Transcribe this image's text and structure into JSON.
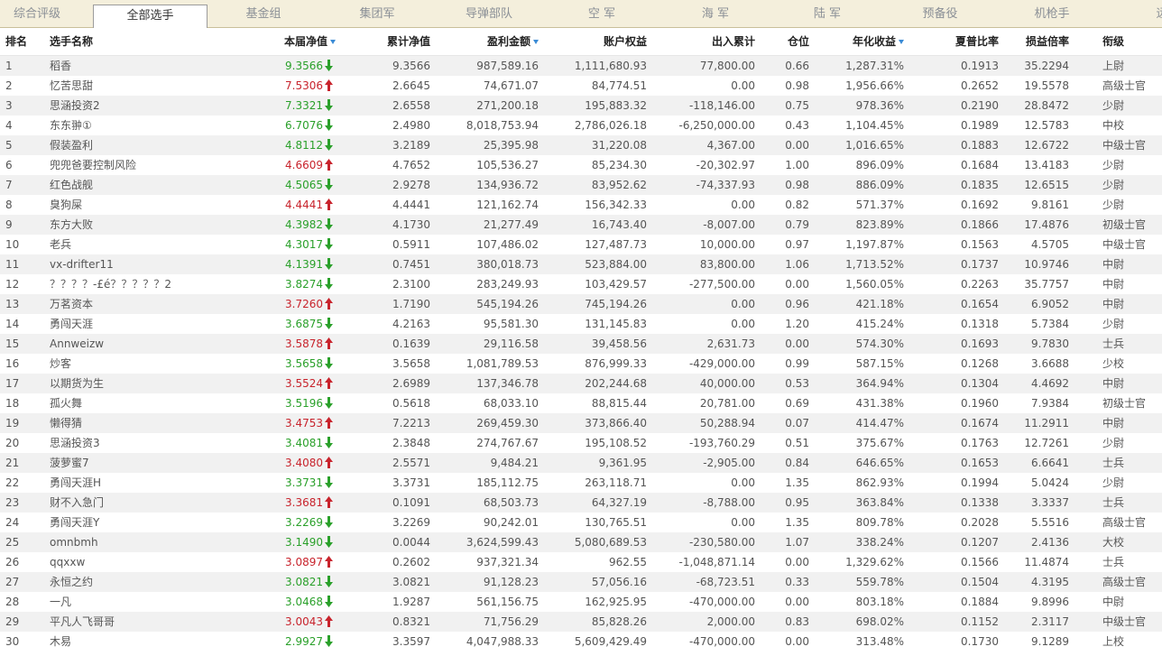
{
  "tabs": [
    {
      "label": "综合评级",
      "active": false
    },
    {
      "label": "全部选手",
      "active": true
    },
    {
      "label": "基金组",
      "active": false
    },
    {
      "label": "集团军",
      "active": false
    },
    {
      "label": "导弹部队",
      "active": false
    },
    {
      "label": "空  军",
      "active": false
    },
    {
      "label": "海  军",
      "active": false
    },
    {
      "label": "陆  军",
      "active": false
    },
    {
      "label": "预备役",
      "active": false
    },
    {
      "label": "机枪手",
      "active": false
    },
    {
      "label": "远",
      "active": false
    }
  ],
  "columns": [
    {
      "key": "rank",
      "label": "排名",
      "sortable": false
    },
    {
      "key": "name",
      "label": "选手名称",
      "sortable": false
    },
    {
      "key": "nav",
      "label": "本届净值",
      "sortable": true
    },
    {
      "key": "cum_nav",
      "label": "累计净值",
      "sortable": false
    },
    {
      "key": "profit",
      "label": "盈利金额",
      "sortable": true
    },
    {
      "key": "equity",
      "label": "账户权益",
      "sortable": false
    },
    {
      "key": "flow",
      "label": "出入累计",
      "sortable": false
    },
    {
      "key": "position",
      "label": "仓位",
      "sortable": false
    },
    {
      "key": "annual",
      "label": "年化收益",
      "sortable": true
    },
    {
      "key": "sharpe",
      "label": "夏普比率",
      "sortable": false
    },
    {
      "key": "pl_ratio",
      "label": "损益倍率",
      "sortable": false
    },
    {
      "key": "grade",
      "label": "衔级",
      "sortable": false
    }
  ],
  "colors": {
    "up": "#c8232c",
    "down": "#2aa02a",
    "accent": "#3a8bd6"
  },
  "rows": [
    {
      "rank": "1",
      "name": "稻香",
      "nav": "9.3566",
      "dir": "down",
      "cum_nav": "9.3566",
      "profit": "987,589.16",
      "equity": "1,111,680.93",
      "flow": "77,800.00",
      "position": "0.66",
      "annual": "1,287.31%",
      "sharpe": "0.1913",
      "pl_ratio": "35.2294",
      "grade": "上尉"
    },
    {
      "rank": "2",
      "name": "忆苦思甜",
      "nav": "7.5306",
      "dir": "up",
      "cum_nav": "2.6645",
      "profit": "74,671.07",
      "equity": "84,774.51",
      "flow": "0.00",
      "position": "0.98",
      "annual": "1,956.66%",
      "sharpe": "0.2652",
      "pl_ratio": "19.5578",
      "grade": "高级士官"
    },
    {
      "rank": "3",
      "name": "思涵投资2",
      "nav": "7.3321",
      "dir": "down",
      "cum_nav": "2.6558",
      "profit": "271,200.18",
      "equity": "195,883.32",
      "flow": "-118,146.00",
      "position": "0.75",
      "annual": "978.36%",
      "sharpe": "0.2190",
      "pl_ratio": "28.8472",
      "grade": "少尉"
    },
    {
      "rank": "4",
      "name": "东东翀①",
      "nav": "6.7076",
      "dir": "down",
      "cum_nav": "2.4980",
      "profit": "8,018,753.94",
      "equity": "2,786,026.18",
      "flow": "-6,250,000.00",
      "position": "0.43",
      "annual": "1,104.45%",
      "sharpe": "0.1989",
      "pl_ratio": "12.5783",
      "grade": "中校"
    },
    {
      "rank": "5",
      "name": "假装盈利",
      "nav": "4.8112",
      "dir": "down",
      "cum_nav": "3.2189",
      "profit": "25,395.98",
      "equity": "31,220.08",
      "flow": "4,367.00",
      "position": "0.00",
      "annual": "1,016.65%",
      "sharpe": "0.1883",
      "pl_ratio": "12.6722",
      "grade": "中级士官"
    },
    {
      "rank": "6",
      "name": "兜兜爸要控制风险",
      "nav": "4.6609",
      "dir": "up",
      "cum_nav": "4.7652",
      "profit": "105,536.27",
      "equity": "85,234.30",
      "flow": "-20,302.97",
      "position": "1.00",
      "annual": "896.09%",
      "sharpe": "0.1684",
      "pl_ratio": "13.4183",
      "grade": "少尉"
    },
    {
      "rank": "7",
      "name": "红色战舰",
      "nav": "4.5065",
      "dir": "down",
      "cum_nav": "2.9278",
      "profit": "134,936.72",
      "equity": "83,952.62",
      "flow": "-74,337.93",
      "position": "0.98",
      "annual": "886.09%",
      "sharpe": "0.1835",
      "pl_ratio": "12.6515",
      "grade": "少尉"
    },
    {
      "rank": "8",
      "name": "臭狗屎",
      "nav": "4.4441",
      "dir": "up",
      "cum_nav": "4.4441",
      "profit": "121,162.74",
      "equity": "156,342.33",
      "flow": "0.00",
      "position": "0.82",
      "annual": "571.37%",
      "sharpe": "0.1692",
      "pl_ratio": "9.8161",
      "grade": "少尉"
    },
    {
      "rank": "9",
      "name": "东方大败",
      "nav": "4.3982",
      "dir": "down",
      "cum_nav": "4.1730",
      "profit": "21,277.49",
      "equity": "16,743.40",
      "flow": "-8,007.00",
      "position": "0.79",
      "annual": "823.89%",
      "sharpe": "0.1866",
      "pl_ratio": "17.4876",
      "grade": "初级士官"
    },
    {
      "rank": "10",
      "name": "老兵",
      "nav": "4.3017",
      "dir": "down",
      "cum_nav": "0.5911",
      "profit": "107,486.02",
      "equity": "127,487.73",
      "flow": "10,000.00",
      "position": "0.97",
      "annual": "1,197.87%",
      "sharpe": "0.1563",
      "pl_ratio": "4.5705",
      "grade": "中级士官"
    },
    {
      "rank": "11",
      "name": "vx-drifter11",
      "nav": "4.1391",
      "dir": "down",
      "cum_nav": "0.7451",
      "profit": "380,018.73",
      "equity": "523,884.00",
      "flow": "83,800.00",
      "position": "1.06",
      "annual": "1,713.52%",
      "sharpe": "0.1737",
      "pl_ratio": "10.9746",
      "grade": "中尉"
    },
    {
      "rank": "12",
      "name": "？？？？-£é？？？？？2",
      "nav": "3.8274",
      "dir": "down",
      "cum_nav": "2.3100",
      "profit": "283,249.93",
      "equity": "103,429.57",
      "flow": "-277,500.00",
      "position": "0.00",
      "annual": "1,560.05%",
      "sharpe": "0.2263",
      "pl_ratio": "35.7757",
      "grade": "中尉"
    },
    {
      "rank": "13",
      "name": "万茗资本",
      "nav": "3.7260",
      "dir": "up",
      "cum_nav": "1.7190",
      "profit": "545,194.26",
      "equity": "745,194.26",
      "flow": "0.00",
      "position": "0.96",
      "annual": "421.18%",
      "sharpe": "0.1654",
      "pl_ratio": "6.9052",
      "grade": "中尉"
    },
    {
      "rank": "14",
      "name": "勇闯天涯",
      "nav": "3.6875",
      "dir": "down",
      "cum_nav": "4.2163",
      "profit": "95,581.30",
      "equity": "131,145.83",
      "flow": "0.00",
      "position": "1.20",
      "annual": "415.24%",
      "sharpe": "0.1318",
      "pl_ratio": "5.7384",
      "grade": "少尉"
    },
    {
      "rank": "15",
      "name": "Annweizw",
      "nav": "3.5878",
      "dir": "up",
      "cum_nav": "0.1639",
      "profit": "29,116.58",
      "equity": "39,458.56",
      "flow": "2,631.73",
      "position": "0.00",
      "annual": "574.30%",
      "sharpe": "0.1693",
      "pl_ratio": "9.7830",
      "grade": "士兵"
    },
    {
      "rank": "16",
      "name": "炒客",
      "nav": "3.5658",
      "dir": "down",
      "cum_nav": "3.5658",
      "profit": "1,081,789.53",
      "equity": "876,999.33",
      "flow": "-429,000.00",
      "position": "0.99",
      "annual": "587.15%",
      "sharpe": "0.1268",
      "pl_ratio": "3.6688",
      "grade": "少校"
    },
    {
      "rank": "17",
      "name": "以期货为生",
      "nav": "3.5524",
      "dir": "up",
      "cum_nav": "2.6989",
      "profit": "137,346.78",
      "equity": "202,244.68",
      "flow": "40,000.00",
      "position": "0.53",
      "annual": "364.94%",
      "sharpe": "0.1304",
      "pl_ratio": "4.4692",
      "grade": "中尉"
    },
    {
      "rank": "18",
      "name": "孤火舞",
      "nav": "3.5196",
      "dir": "down",
      "cum_nav": "0.5618",
      "profit": "68,033.10",
      "equity": "88,815.44",
      "flow": "20,781.00",
      "position": "0.69",
      "annual": "431.38%",
      "sharpe": "0.1960",
      "pl_ratio": "7.9384",
      "grade": "初级士官"
    },
    {
      "rank": "19",
      "name": "懒得猜",
      "nav": "3.4753",
      "dir": "up",
      "cum_nav": "7.2213",
      "profit": "269,459.30",
      "equity": "373,866.40",
      "flow": "50,288.94",
      "position": "0.07",
      "annual": "414.47%",
      "sharpe": "0.1674",
      "pl_ratio": "11.2911",
      "grade": "中尉"
    },
    {
      "rank": "20",
      "name": "思涵投资3",
      "nav": "3.4081",
      "dir": "down",
      "cum_nav": "2.3848",
      "profit": "274,767.67",
      "equity": "195,108.52",
      "flow": "-193,760.29",
      "position": "0.51",
      "annual": "375.67%",
      "sharpe": "0.1763",
      "pl_ratio": "12.7261",
      "grade": "少尉"
    },
    {
      "rank": "21",
      "name": "菠萝蜜7",
      "nav": "3.4080",
      "dir": "up",
      "cum_nav": "2.5571",
      "profit": "9,484.21",
      "equity": "9,361.95",
      "flow": "-2,905.00",
      "position": "0.84",
      "annual": "646.65%",
      "sharpe": "0.1653",
      "pl_ratio": "6.6641",
      "grade": "士兵"
    },
    {
      "rank": "22",
      "name": "勇闯天涯H",
      "nav": "3.3731",
      "dir": "down",
      "cum_nav": "3.3731",
      "profit": "185,112.75",
      "equity": "263,118.71",
      "flow": "0.00",
      "position": "1.35",
      "annual": "862.93%",
      "sharpe": "0.1994",
      "pl_ratio": "5.0424",
      "grade": "少尉"
    },
    {
      "rank": "23",
      "name": "财不入急门",
      "nav": "3.3681",
      "dir": "up",
      "cum_nav": "0.1091",
      "profit": "68,503.73",
      "equity": "64,327.19",
      "flow": "-8,788.00",
      "position": "0.95",
      "annual": "363.84%",
      "sharpe": "0.1338",
      "pl_ratio": "3.3337",
      "grade": "士兵"
    },
    {
      "rank": "24",
      "name": "勇闯天涯Y",
      "nav": "3.2269",
      "dir": "down",
      "cum_nav": "3.2269",
      "profit": "90,242.01",
      "equity": "130,765.51",
      "flow": "0.00",
      "position": "1.35",
      "annual": "809.78%",
      "sharpe": "0.2028",
      "pl_ratio": "5.5516",
      "grade": "高级士官"
    },
    {
      "rank": "25",
      "name": "omnbmh",
      "nav": "3.1490",
      "dir": "down",
      "cum_nav": "0.0044",
      "profit": "3,624,599.43",
      "equity": "5,080,689.53",
      "flow": "-230,580.00",
      "position": "1.07",
      "annual": "338.24%",
      "sharpe": "0.1207",
      "pl_ratio": "2.4136",
      "grade": "大校"
    },
    {
      "rank": "26",
      "name": "qqxxw",
      "nav": "3.0897",
      "dir": "up",
      "cum_nav": "0.2602",
      "profit": "937,321.34",
      "equity": "962.55",
      "flow": "-1,048,871.14",
      "position": "0.00",
      "annual": "1,329.62%",
      "sharpe": "0.1566",
      "pl_ratio": "11.4874",
      "grade": "士兵"
    },
    {
      "rank": "27",
      "name": "永恒之约",
      "nav": "3.0821",
      "dir": "down",
      "cum_nav": "3.0821",
      "profit": "91,128.23",
      "equity": "57,056.16",
      "flow": "-68,723.51",
      "position": "0.33",
      "annual": "559.78%",
      "sharpe": "0.1504",
      "pl_ratio": "4.3195",
      "grade": "高级士官"
    },
    {
      "rank": "28",
      "name": "一凡",
      "nav": "3.0468",
      "dir": "down",
      "cum_nav": "1.9287",
      "profit": "561,156.75",
      "equity": "162,925.95",
      "flow": "-470,000.00",
      "position": "0.00",
      "annual": "803.18%",
      "sharpe": "0.1884",
      "pl_ratio": "9.8996",
      "grade": "中尉"
    },
    {
      "rank": "29",
      "name": "平凡人飞哥哥",
      "nav": "3.0043",
      "dir": "up",
      "cum_nav": "0.8321",
      "profit": "71,756.29",
      "equity": "85,828.26",
      "flow": "2,000.00",
      "position": "0.83",
      "annual": "698.02%",
      "sharpe": "0.1152",
      "pl_ratio": "2.3117",
      "grade": "中级士官"
    },
    {
      "rank": "30",
      "name": "木易",
      "nav": "2.9927",
      "dir": "down",
      "cum_nav": "3.3597",
      "profit": "4,047,988.33",
      "equity": "5,609,429.49",
      "flow": "-470,000.00",
      "position": "0.00",
      "annual": "313.48%",
      "sharpe": "0.1730",
      "pl_ratio": "9.1289",
      "grade": "上校"
    }
  ]
}
